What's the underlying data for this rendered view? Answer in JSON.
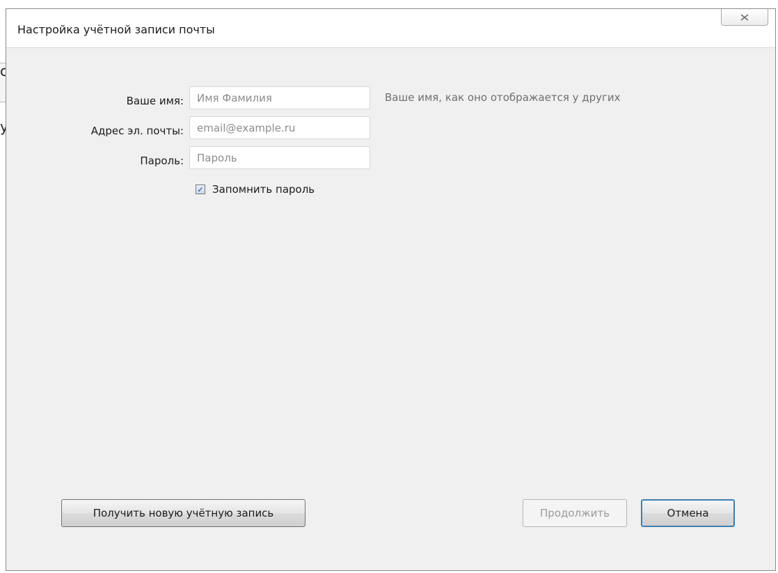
{
  "background_app": {
    "chars": [
      "с",
      "у"
    ]
  },
  "dialog": {
    "title": "Настройка учётной записи почты",
    "close_icon": "close-icon"
  },
  "form": {
    "name": {
      "label": "Ваше имя:",
      "placeholder": "Имя Фамилия",
      "hint": "Ваше имя, как оно отображается у других"
    },
    "email": {
      "label": "Адрес эл. почты:",
      "placeholder": "email@example.ru"
    },
    "password": {
      "label": "Пароль:",
      "placeholder": "Пароль"
    },
    "remember": {
      "label": "Запомнить пароль",
      "checked": true
    }
  },
  "buttons": {
    "new_account": "Получить новую учётную запись",
    "continue": "Продолжить",
    "cancel": "Отмена"
  }
}
